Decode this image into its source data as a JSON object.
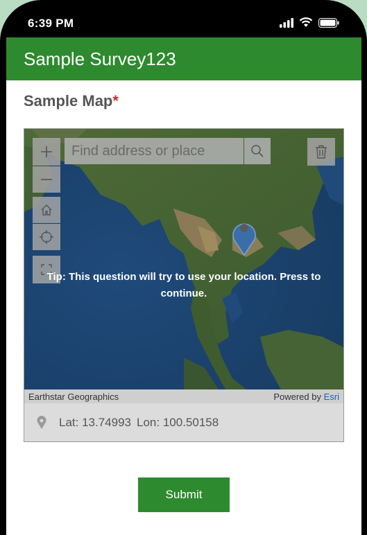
{
  "status_bar": {
    "time": "6:39 PM"
  },
  "app": {
    "title": "Sample Survey123"
  },
  "question": {
    "label": "Sample Map",
    "required_marker": "*"
  },
  "map": {
    "search_placeholder": "Find address or place",
    "tip": "Tip: This question will try to use your location. Press to continue.",
    "attribution": "Earthstar Geographics",
    "powered_by": "Powered by",
    "esri_link": "Esri",
    "coordinates": {
      "lat_label": "Lat:",
      "lat": "13.74993",
      "lon_label": "Lon:",
      "lon": "100.50158"
    }
  },
  "submit_label": "Submit",
  "colors": {
    "brand_green": "#2e8a2e",
    "required_red": "#b83232",
    "pin_blue": "#3a6ea8"
  }
}
